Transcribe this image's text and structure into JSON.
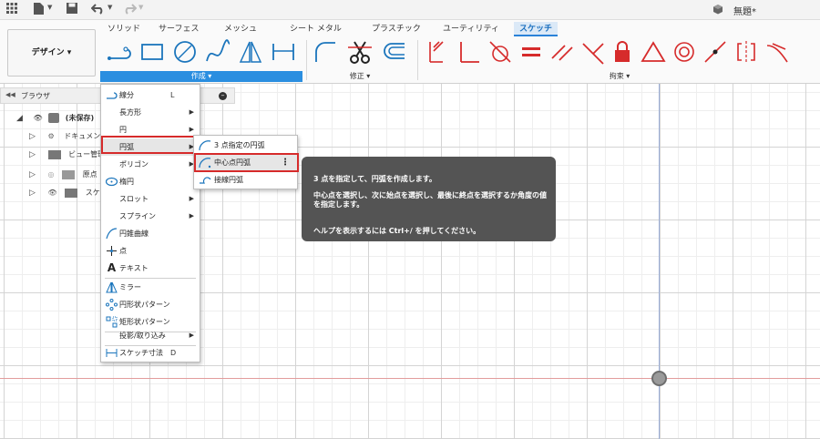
{
  "window": {
    "doc_title": "無題*"
  },
  "ribbon": {
    "workspace_label": "デザイン ▾",
    "tabs": [
      "ソリッド",
      "サーフェス",
      "メッシュ",
      "シート メタル",
      "プラスチック",
      "ユーティリティ",
      "スケッチ"
    ],
    "active_tab": "スケッチ",
    "groups": {
      "create": "作成 ▾",
      "modify": "修正 ▾",
      "constraints": "拘束 ▾"
    }
  },
  "browser": {
    "title": "ブラウザ",
    "rows": [
      {
        "label": "(未保存)"
      },
      {
        "label": "ドキュメン"
      },
      {
        "label": "ビュー管理"
      },
      {
        "label": "原点"
      },
      {
        "label": "スケ"
      }
    ]
  },
  "menu": {
    "items": [
      {
        "label": "線分",
        "shortcut": "L",
        "icon": "line-icon"
      },
      {
        "label": "長方形",
        "submenu": true
      },
      {
        "label": "円",
        "submenu": true
      },
      {
        "label": "円弧",
        "submenu": true,
        "highlighted": true
      },
      {
        "label": "ポリゴン",
        "submenu": true
      },
      {
        "label": "楕円",
        "icon": "ellipse-icon"
      },
      {
        "label": "スロット",
        "submenu": true
      },
      {
        "label": "スプライン",
        "submenu": true
      },
      {
        "label": "円錐曲線",
        "icon": "conic-curve-icon"
      },
      {
        "label": "点",
        "icon": "point-icon"
      },
      {
        "label": "テキスト",
        "icon": "text-icon"
      },
      {
        "label": "ミラー",
        "icon": "mirror-icon"
      },
      {
        "label": "円形状パターン",
        "icon": "circular-pattern-icon"
      },
      {
        "label": "矩形状パターン",
        "icon": "rectangular-pattern-icon"
      },
      {
        "label": "投影/取り込み",
        "submenu": true
      },
      {
        "label": "スケッチ寸法",
        "shortcut": "D",
        "icon": "sketch-dimension-icon"
      }
    ]
  },
  "submenu": {
    "items": [
      {
        "label": "3 点指定の円弧"
      },
      {
        "label": "中心点円弧",
        "highlighted": true
      },
      {
        "label": "接線円弧"
      }
    ]
  },
  "tooltip": {
    "line1": "3 点を指定して、円弧を作成します。",
    "line2": "中心点を選択し、次に始点を選択し、最後に終点を選択するか角度の値を指定します。",
    "line3": "ヘルプを表示するには Ctrl+/ を押してください。"
  },
  "colors": {
    "accent": "#2a8ee0",
    "highlight_border": "#d62b2b",
    "tooltip_bg": "#545454",
    "sketch_red": "#d62b2b"
  }
}
